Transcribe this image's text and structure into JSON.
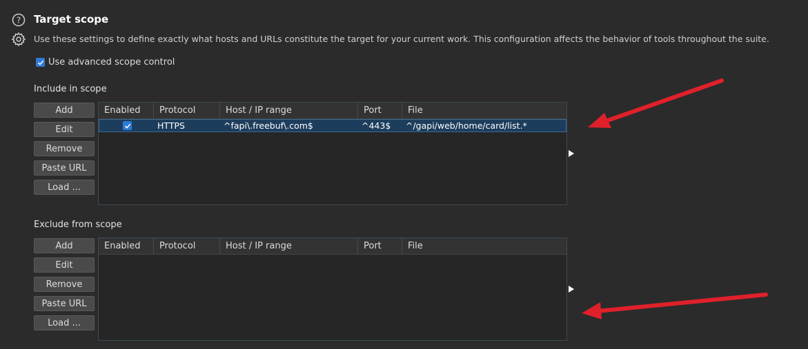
{
  "header": {
    "title": "Target scope",
    "description": "Use these settings to define exactly what hosts and URLs constitute the target for your current work. This configuration affects the behavior of tools throughout the suite."
  },
  "advanced_scope": {
    "label": "Use advanced scope control",
    "checked": true
  },
  "include": {
    "label": "Include in scope",
    "buttons": [
      "Add",
      "Edit",
      "Remove",
      "Paste URL",
      "Load ..."
    ],
    "columns": [
      "Enabled",
      "Protocol",
      "Host / IP range",
      "Port",
      "File"
    ],
    "rows": [
      {
        "enabled": true,
        "protocol": "HTTPS",
        "host": "^fapi\\.freebuf\\.com$",
        "port": "^443$",
        "file": "^/gapi/web/home/card/list.*"
      }
    ]
  },
  "exclude": {
    "label": "Exclude from scope",
    "buttons": [
      "Add",
      "Edit",
      "Remove",
      "Paste URL",
      "Load ..."
    ],
    "columns": [
      "Enabled",
      "Protocol",
      "Host / IP range",
      "Port",
      "File"
    ],
    "rows": []
  },
  "colors": {
    "accent": "#2f7ad8",
    "annotation_arrow": "#e0202a",
    "background": "#2b2b2b"
  }
}
